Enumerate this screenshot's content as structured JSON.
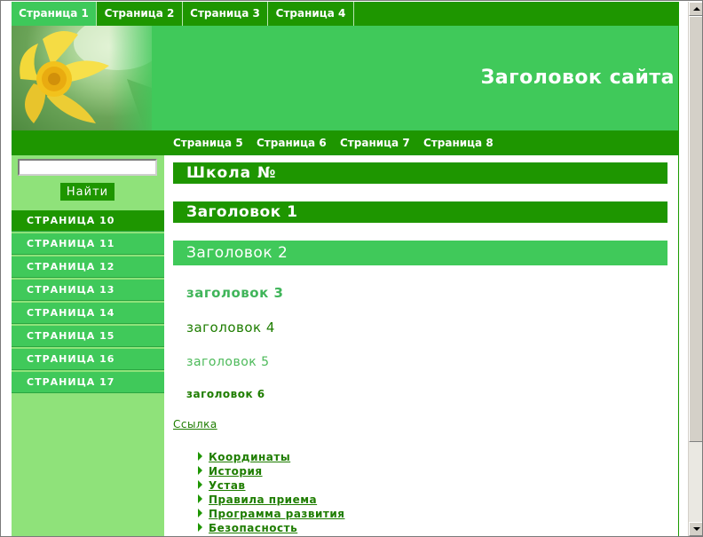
{
  "colors": {
    "dark_green": "#1e9600",
    "light_green": "#40c95a",
    "pale_green": "#8fe27a",
    "link_green": "#1e7d00"
  },
  "top_nav": [
    {
      "label": "Страница 1",
      "active": true
    },
    {
      "label": "Страница 2"
    },
    {
      "label": "Страница 3"
    },
    {
      "label": "Страница 4"
    }
  ],
  "header": {
    "title": "Заголовок сайта",
    "image": "daffodil-flower-photo"
  },
  "sub_nav": [
    "Страница 5",
    "Страница 6",
    "Страница 7",
    "Страница 8"
  ],
  "search": {
    "value": "",
    "button": "Найти"
  },
  "side_menu": [
    {
      "label": "СТРАНИЦА 10",
      "active": true
    },
    {
      "label": "СТРАНИЦА 11"
    },
    {
      "label": "СТРАНИЦА 12"
    },
    {
      "label": "СТРАНИЦА 13"
    },
    {
      "label": "СТРАНИЦА 14"
    },
    {
      "label": "СТРАНИЦА 15"
    },
    {
      "label": "СТРАНИЦА 16"
    },
    {
      "label": "СТРАНИЦА 17"
    }
  ],
  "content": {
    "school_heading": "Школа №",
    "h1": "Заголовок 1",
    "h2": "Заголовок 2",
    "h3": "заголовок 3",
    "h4": "заголовок 4",
    "h5": "заголовок 5",
    "h6": "заголовок 6",
    "link": "Ссылка",
    "list": [
      "Координаты",
      "История",
      "Устав",
      "Правила приема",
      "Программа развития",
      "Безопасность"
    ]
  }
}
